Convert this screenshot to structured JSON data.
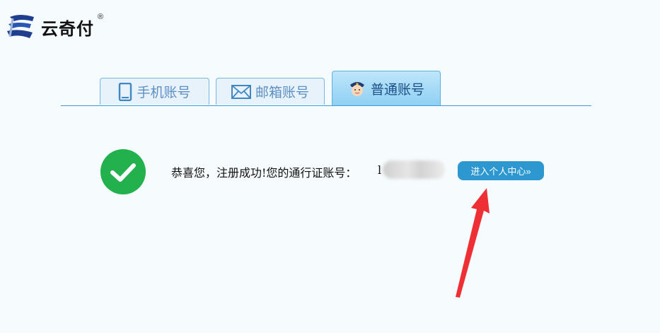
{
  "brand": {
    "name": "云奇付",
    "registered_mark": "®"
  },
  "tabs": [
    {
      "label": "手机账号",
      "icon": "phone-icon",
      "active": false
    },
    {
      "label": "邮箱账号",
      "icon": "mail-icon",
      "active": false
    },
    {
      "label": "普通账号",
      "icon": "police-avatar-icon",
      "active": true
    }
  ],
  "result": {
    "status_icon": "check-circle-icon",
    "message": "恭喜您，注册成功!您的通行证账号：",
    "account_visible_part": "l"
  },
  "actions": {
    "enter_center_label": "进入个人中心»"
  },
  "colors": {
    "accent": "#2d98d0",
    "success": "#22b14c",
    "annotation_arrow": "#ee3035",
    "tab_text": "#5d90c4"
  }
}
